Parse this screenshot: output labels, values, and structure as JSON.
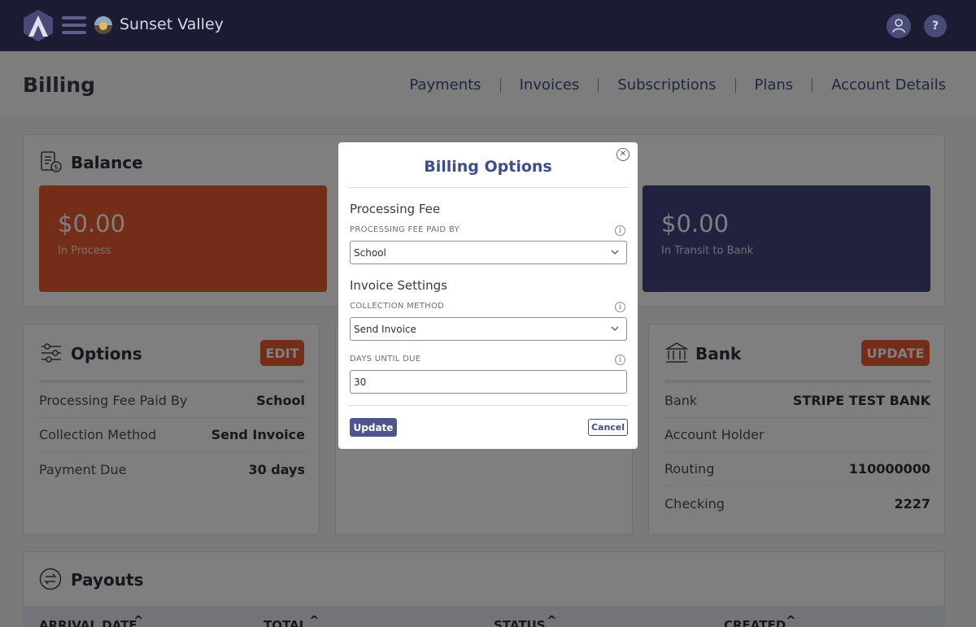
{
  "app": {
    "school_name": "Sunset Valley"
  },
  "header": {
    "title": "Billing",
    "tabs": [
      "Payments",
      "Invoices",
      "Subscriptions",
      "Plans",
      "Account Details"
    ],
    "user_icon": "user-icon",
    "help_label": "?"
  },
  "balance": {
    "title": "Balance",
    "tiles": [
      {
        "amount": "$0.00",
        "label": "In Process",
        "color": "#e85b30"
      },
      {
        "amount": "$0.00",
        "label": "In Transit to Bank",
        "color": "#404580"
      }
    ]
  },
  "options": {
    "title": "Options",
    "edit_label": "EDIT",
    "rows": [
      {
        "key": "Processing Fee Paid By",
        "value": "School"
      },
      {
        "key": "Collection Method",
        "value": "Send Invoice"
      },
      {
        "key": "Payment Due",
        "value": "30 days"
      }
    ]
  },
  "bank": {
    "title": "Bank",
    "update_label": "UPDATE",
    "rows": [
      {
        "key": "Bank",
        "value": "STRIPE TEST BANK"
      },
      {
        "key": "Account Holder",
        "value": ""
      },
      {
        "key": "Routing",
        "value": "110000000"
      },
      {
        "key": "Checking",
        "value": "2227"
      }
    ]
  },
  "payouts": {
    "title": "Payouts",
    "columns": [
      "ARRIVAL DATE",
      "TOTAL",
      "STATUS",
      "CREATED"
    ]
  },
  "modal": {
    "title": "Billing Options",
    "close_icon": "close-circle-icon",
    "processing_section": "Processing Fee",
    "processing_fee_label": "PROCESSING FEE PAID BY",
    "processing_fee_value": "School",
    "invoice_section": "Invoice Settings",
    "collection_label": "COLLECTION METHOD",
    "collection_value": "Send Invoice",
    "days_label": "DAYS UNTIL DUE",
    "days_value": "30",
    "update_label": "Update",
    "cancel_label": "Cancel"
  },
  "colors": {
    "navbar": "#1b1b33",
    "accent": "#e85b30",
    "brand": "#3f4e86"
  }
}
